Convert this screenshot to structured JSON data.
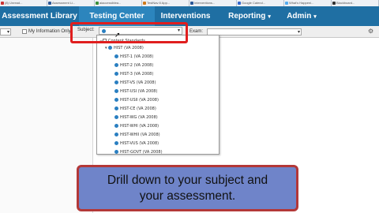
{
  "browser_tabs": [
    {
      "label": "(8) Unread...",
      "color": "#cc3333"
    },
    {
      "label": "Assessment Li...",
      "color": "#2b5797"
    },
    {
      "label": "aiaccessiblea...",
      "color": "#3a8f3a"
    },
    {
      "label": "TestNav 8 App...",
      "color": "#d07a1a"
    },
    {
      "label": "Interventions...",
      "color": "#2b5797"
    },
    {
      "label": "Google Calend...",
      "color": "#3366cc"
    },
    {
      "label": "What's Happeni...",
      "color": "#55acee"
    },
    {
      "label": "Blackboard...",
      "color": "#333333"
    }
  ],
  "nav": {
    "assessment_library": "Assessment Library",
    "testing_center": "Testing Center",
    "interventions": "Interventions",
    "reporting": "Reporting",
    "admin": "Admin",
    "caret": "▾"
  },
  "toolbar": {
    "my_information_label": "My Information Only",
    "subject_label": "Subject:",
    "exam_label": "Exam:",
    "arrow": "▾",
    "gear": "⚙"
  },
  "tree": {
    "root_label": "Content Standards",
    "parent_label": "HIST (VA 2008)",
    "items": [
      "HIST-1 (VA 2008)",
      "HIST-2 (VA 2008)",
      "HIST-3 (VA 2008)",
      "HIST-VS (VA 2008)",
      "HIST-USI (VA 2008)",
      "HIST-USII (VA 2008)",
      "HIST-CE (VA 2008)",
      "HIST-WG (VA 2008)",
      "HIST-WHI (VA 2008)",
      "HIST-WHII (VA 2008)",
      "HIST-VUS (VA 2008)",
      "HIST-GOVT (VA 2008)"
    ]
  },
  "callout": {
    "line1": "Drill down to your subject and",
    "line2": "your assessment."
  },
  "colors": {
    "nav_bg": "#1f6fa3",
    "nav_active": "#2c85bd",
    "highlight": "#e01e1e",
    "callout_bg": "#6f84c9",
    "callout_border": "#b33838",
    "tree_dot": "#2a7fc1"
  }
}
